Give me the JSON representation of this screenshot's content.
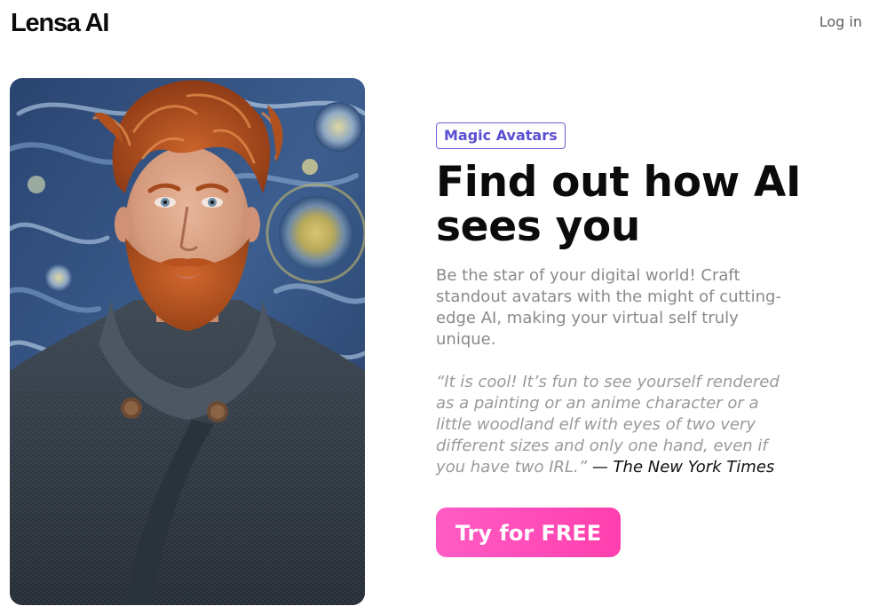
{
  "header": {
    "logo": "Lensa AI",
    "login_label": "Log in"
  },
  "hero": {
    "image_alt": "Portrait of a red-haired bearded man in a dark knit coat painted in a starry-night style",
    "badge": "Magic Avatars",
    "title": "Find out how AI sees you",
    "description": "Be the star of your digital world! Craft standout avatars with the might of cutting-edge AI, making your virtual self truly unique.",
    "quote": "“It is cool! It’s fun to see yourself rendered as a painting or an anime character or a little woodland elf with eyes of two very different sizes and only one hand, even if you have two IRL.”",
    "quote_dash": " — ",
    "quote_source": "The New York Times",
    "cta_label": "Try for FREE"
  },
  "colors": {
    "badge": "#5b4fd1",
    "cta_start": "#ff5cc4",
    "cta_end": "#ff3fae",
    "text_muted": "#8a8a8a"
  }
}
